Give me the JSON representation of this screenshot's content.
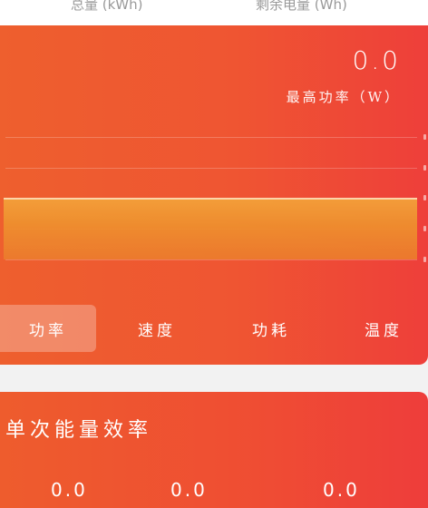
{
  "top": {
    "label_left": "总量 (kWh)",
    "label_right": "剩余电量 (Wh)"
  },
  "power_card": {
    "peak_value": "0.0",
    "peak_label": "最高功率（W）",
    "colors": {
      "gradient_start": "#ee5f2e",
      "gradient_end": "#ee3f3a",
      "bar": "#ee8e2e"
    },
    "progress_fill": 1.0
  },
  "tabs": [
    {
      "label": "功率",
      "active": true
    },
    {
      "label": "速度",
      "active": false
    },
    {
      "label": "功耗",
      "active": false
    },
    {
      "label": "温度",
      "active": false
    }
  ],
  "efficiency_card": {
    "title": "单次能量效率",
    "values": [
      "0.0",
      "0.0",
      "0.0"
    ]
  }
}
